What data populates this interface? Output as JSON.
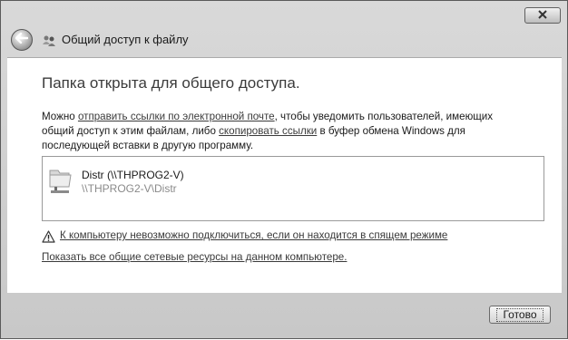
{
  "window": {
    "title": "Общий доступ к файлу",
    "close_icon": "close-icon",
    "back_icon": "back-arrow-icon"
  },
  "main": {
    "heading": "Папка открыта для общего доступа.",
    "description": {
      "part1": "Можно ",
      "link_email": "отправить ссылки по электронной почте",
      "part2": ", чтобы уведомить пользователей, имеющих общий доступ к этим файлам, либо ",
      "link_copy": "скопировать ссылки",
      "part3": " в буфер обмена Windows для последующей вставки в другую программу."
    },
    "shares": [
      {
        "name": "Distr (\\\\THPROG2-V)",
        "path": "\\\\THPROG2-V\\Distr",
        "icon": "shared-folder-icon"
      }
    ],
    "warning_link": "К компьютеру невозможно подключиться, если он находится в спящем режиме",
    "show_all_link": "Показать все общие сетевые ресурсы на данном компьютере."
  },
  "footer": {
    "done_label": "Готово"
  },
  "colors": {
    "chrome": "#c8c8c8",
    "content_bg": "#ffffff",
    "heading": "#3b3b3b",
    "muted_path": "#8a8a8a"
  }
}
